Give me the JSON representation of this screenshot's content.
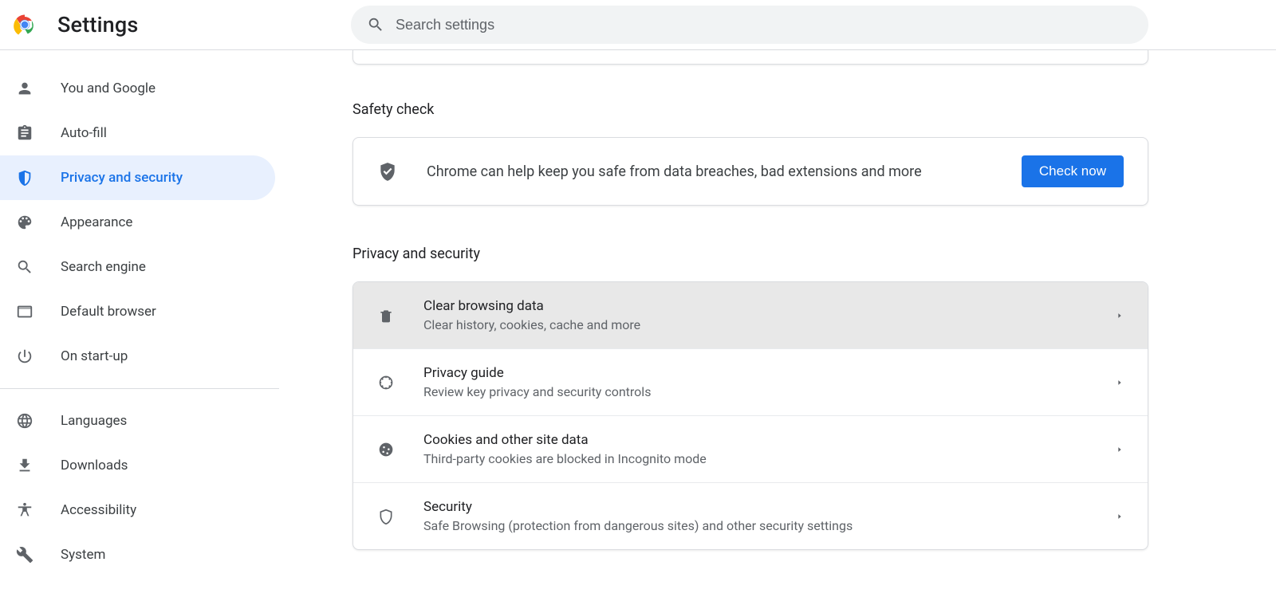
{
  "header": {
    "title": "Settings"
  },
  "search": {
    "placeholder": "Search settings"
  },
  "sidebar": {
    "items": [
      {
        "label": "You and Google"
      },
      {
        "label": "Auto-fill"
      },
      {
        "label": "Privacy and security"
      },
      {
        "label": "Appearance"
      },
      {
        "label": "Search engine"
      },
      {
        "label": "Default browser"
      },
      {
        "label": "On start-up"
      }
    ],
    "items2": [
      {
        "label": "Languages"
      },
      {
        "label": "Downloads"
      },
      {
        "label": "Accessibility"
      },
      {
        "label": "System"
      }
    ]
  },
  "safety": {
    "heading": "Safety check",
    "text": "Chrome can help keep you safe from data breaches, bad extensions and more",
    "button": "Check now"
  },
  "privacy": {
    "heading": "Privacy and security",
    "rows": [
      {
        "title": "Clear browsing data",
        "sub": "Clear history, cookies, cache and more"
      },
      {
        "title": "Privacy guide",
        "sub": "Review key privacy and security controls"
      },
      {
        "title": "Cookies and other site data",
        "sub": "Third-party cookies are blocked in Incognito mode"
      },
      {
        "title": "Security",
        "sub": "Safe Browsing (protection from dangerous sites) and other security settings"
      }
    ]
  }
}
